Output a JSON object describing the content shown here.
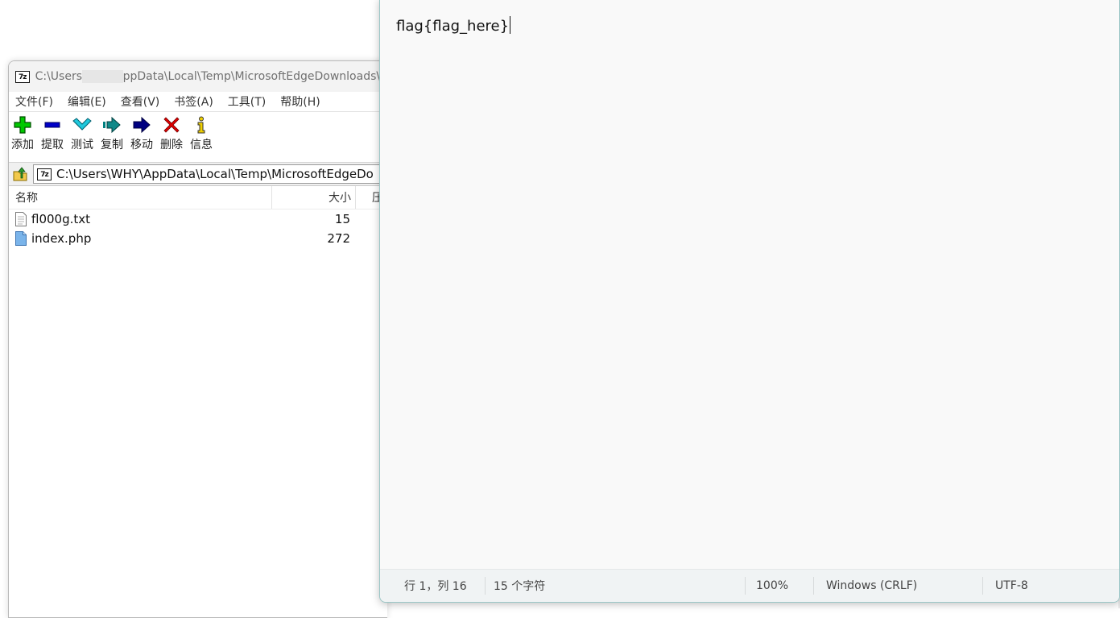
{
  "zip": {
    "title_prefix": "C:\\Users",
    "title_suffix": "ppData\\Local\\Temp\\MicrosoftEdgeDownloads\\b",
    "menu": [
      "文件(F)",
      "编辑(E)",
      "查看(V)",
      "书签(A)",
      "工具(T)",
      "帮助(H)"
    ],
    "toolbar": [
      {
        "label": "添加",
        "icon": "add-icon"
      },
      {
        "label": "提取",
        "icon": "extract-icon"
      },
      {
        "label": "测试",
        "icon": "test-icon"
      },
      {
        "label": "复制",
        "icon": "copy-icon"
      },
      {
        "label": "移动",
        "icon": "move-icon"
      },
      {
        "label": "删除",
        "icon": "delete-icon"
      },
      {
        "label": "信息",
        "icon": "info-icon"
      }
    ],
    "address": "C:\\Users\\WHY\\AppData\\Local\\Temp\\MicrosoftEdgeDo",
    "columns": {
      "name": "名称",
      "size": "大小",
      "compressed": "压"
    },
    "files": [
      {
        "name": "fl000g.txt",
        "size": "15",
        "icon": "text-file-icon"
      },
      {
        "name": "index.php",
        "size": "272",
        "icon": "php-file-icon"
      }
    ],
    "colors": {
      "add": "#00c800",
      "extract": "#0000c8",
      "test": "#00b4c8",
      "copy": "#008080",
      "move": "#000080",
      "delete": "#e00000",
      "info": "#d4b000"
    }
  },
  "notepad": {
    "content": "flag{flag_here}",
    "status": {
      "position": "行 1，列 16",
      "chars": "15 个字符",
      "zoom": "100%",
      "line_ending": "Windows (CRLF)",
      "encoding": "UTF-8"
    }
  }
}
